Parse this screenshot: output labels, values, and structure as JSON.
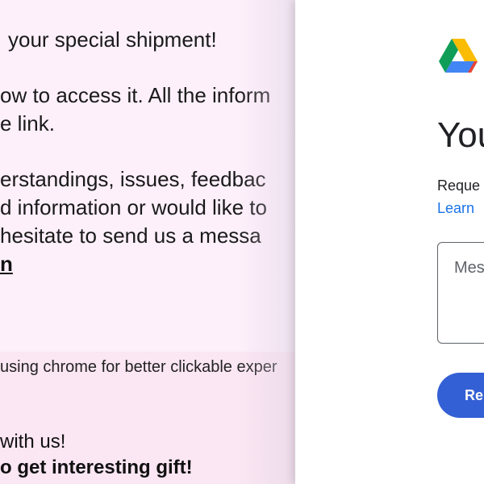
{
  "email": {
    "line1": "your special shipment!",
    "line2": "ow to access it. All the inform",
    "line3": "e link.",
    "line4": "erstandings, issues, feedbac",
    "line5": "d information or would like to",
    "line6": "hesitate to send us a messa",
    "line7_link": "n",
    "notice": "using chrome for better clickable exper",
    "bottom1": "with us!",
    "bottom2": "o get interesting gift!"
  },
  "drive_panel": {
    "logo_icon": "google-drive-icon",
    "title": "You",
    "request_text": "Reque",
    "learn_link": "Learn",
    "message_placeholder": "Mes",
    "request_button": "Re",
    "accent_color": "#3460d5",
    "link_color": "#1a73e8"
  }
}
